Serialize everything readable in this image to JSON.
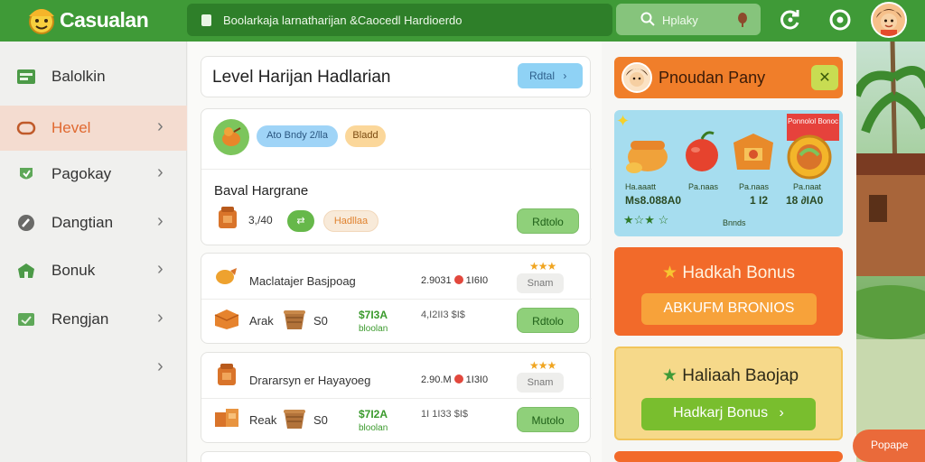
{
  "app": {
    "title": "Casualan"
  },
  "urlbar": {
    "text": "Boolarkaja larnatharijan &Caocedl Hardioerdo"
  },
  "search": {
    "placeholder": "Hplaky"
  },
  "icons": {
    "reload": "refresh-icon",
    "settings": "settings-icon",
    "profile": "avatar"
  },
  "sidebar": {
    "items": [
      {
        "label": "Balolkin",
        "icon": "inbox-icon",
        "active": false,
        "chevron": false
      },
      {
        "label": "Hevel",
        "icon": "level-icon",
        "active": true,
        "chevron": true
      },
      {
        "label": "Pagokay",
        "icon": "shield-icon",
        "active": false,
        "chevron": true
      },
      {
        "label": "Dangtian",
        "icon": "compass-icon",
        "active": false,
        "chevron": true
      },
      {
        "label": "Bonuk",
        "icon": "gift-icon",
        "active": false,
        "chevron": true
      },
      {
        "label": "Rengjan",
        "icon": "bag-icon",
        "active": false,
        "chevron": true
      }
    ],
    "extra_chevron": "›"
  },
  "main": {
    "header": {
      "title": "Level Harijan Hadlarian",
      "button": "Rdtal"
    },
    "feature": {
      "tag1": "Ato Bndy 2/lla",
      "tag2": "Bladd",
      "subtitle": "Baval Hargrane",
      "value": "3,/40",
      "pill_green": "",
      "pill_orange": "Hadllaa",
      "button": "Rdtolo"
    },
    "rows": [
      {
        "title": "Maclatajer Basjpoag",
        "stat": "2.9031",
        "stat2": "1I6I0",
        "rating": "★★★",
        "gray_button": "Snam",
        "item_label": "Arak",
        "count": "S0",
        "price": "$7I3A",
        "price_sub": "bloolan",
        "price2": "4,I2II3 $I$",
        "button": "Rdtolo"
      },
      {
        "title": "Drararsyn er Hayayoeg",
        "stat": "2.90.M",
        "stat2": "1I3I0",
        "rating": "★★★",
        "gray_button": "Snam",
        "item_label": "Reak",
        "count": "S0",
        "price": "$7I2A",
        "price_sub": "bloolan",
        "price2": "1I 1I33 $I$",
        "button": "Mutolo"
      }
    ]
  },
  "right": {
    "header": {
      "title": "Pnoudan Pany",
      "close": "✕"
    },
    "shop": {
      "ribbon": "Ponnolol Bonoc",
      "items": [
        "Ms8.088A0",
        "",
        "1 I2",
        "18 ∂IA0"
      ],
      "small_labels": [
        "Ha.aaatt",
        "Pa.naas",
        "Pa.naas",
        "Pa.naat"
      ],
      "stars": "★☆★ ☆",
      "bottom_label": "Bnnds"
    },
    "bonus1": {
      "title": "Hadkah Bonus",
      "button": "ABKUFM BRONIOS"
    },
    "bonus2": {
      "title": "Haliaah Baojap",
      "button": "Hadkarj Bonus"
    }
  },
  "fab": {
    "label": "Popape"
  },
  "colors": {
    "brand": "#3f9a37",
    "accent": "#f07e2a",
    "active": "#e06930",
    "button_green": "#8fd07a"
  }
}
